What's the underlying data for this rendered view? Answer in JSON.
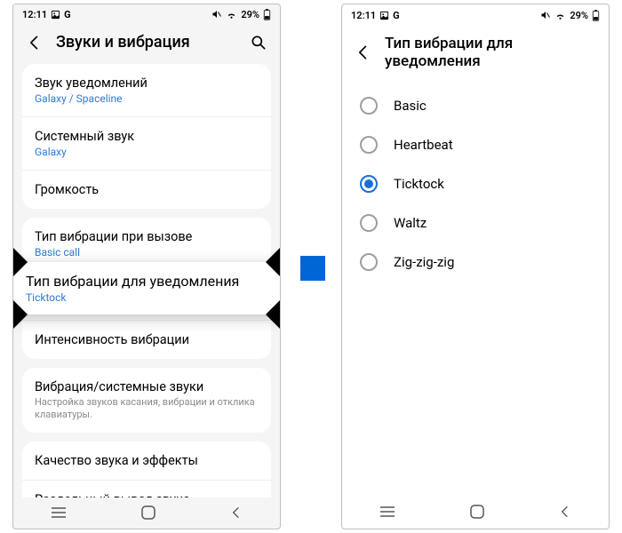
{
  "status": {
    "time": "12:11",
    "icons_left": [
      "image-icon",
      "g-icon"
    ],
    "battery_text": "29%"
  },
  "left": {
    "title": "Звуки и вибрация",
    "groups": [
      [
        {
          "title": "Звук уведомлений",
          "sub": "Galaxy / Spaceline"
        },
        {
          "title": "Системный звук",
          "sub": "Galaxy"
        },
        {
          "title": "Громкость"
        }
      ],
      [
        {
          "title": "Тип вибрации при вызове",
          "sub": "Basic call"
        },
        {
          "title": "Тип вибрации для уведомления",
          "sub": "Ticktock",
          "highlight": true
        },
        {
          "title": "Интенсивность вибрации"
        }
      ],
      [
        {
          "title": "Вибрация/системные звуки",
          "desc": "Настройка звуков касания, вибрации и отклика клавиатуры."
        }
      ],
      [
        {
          "title": "Качество звука и эффекты"
        },
        {
          "title": "Раздельный вывод звука"
        }
      ]
    ]
  },
  "right": {
    "title": "Тип вибрации для уведомления",
    "options": [
      "Basic",
      "Heartbeat",
      "Ticktock",
      "Waltz",
      "Zig-zig-zig"
    ],
    "selected": "Ticktock"
  }
}
